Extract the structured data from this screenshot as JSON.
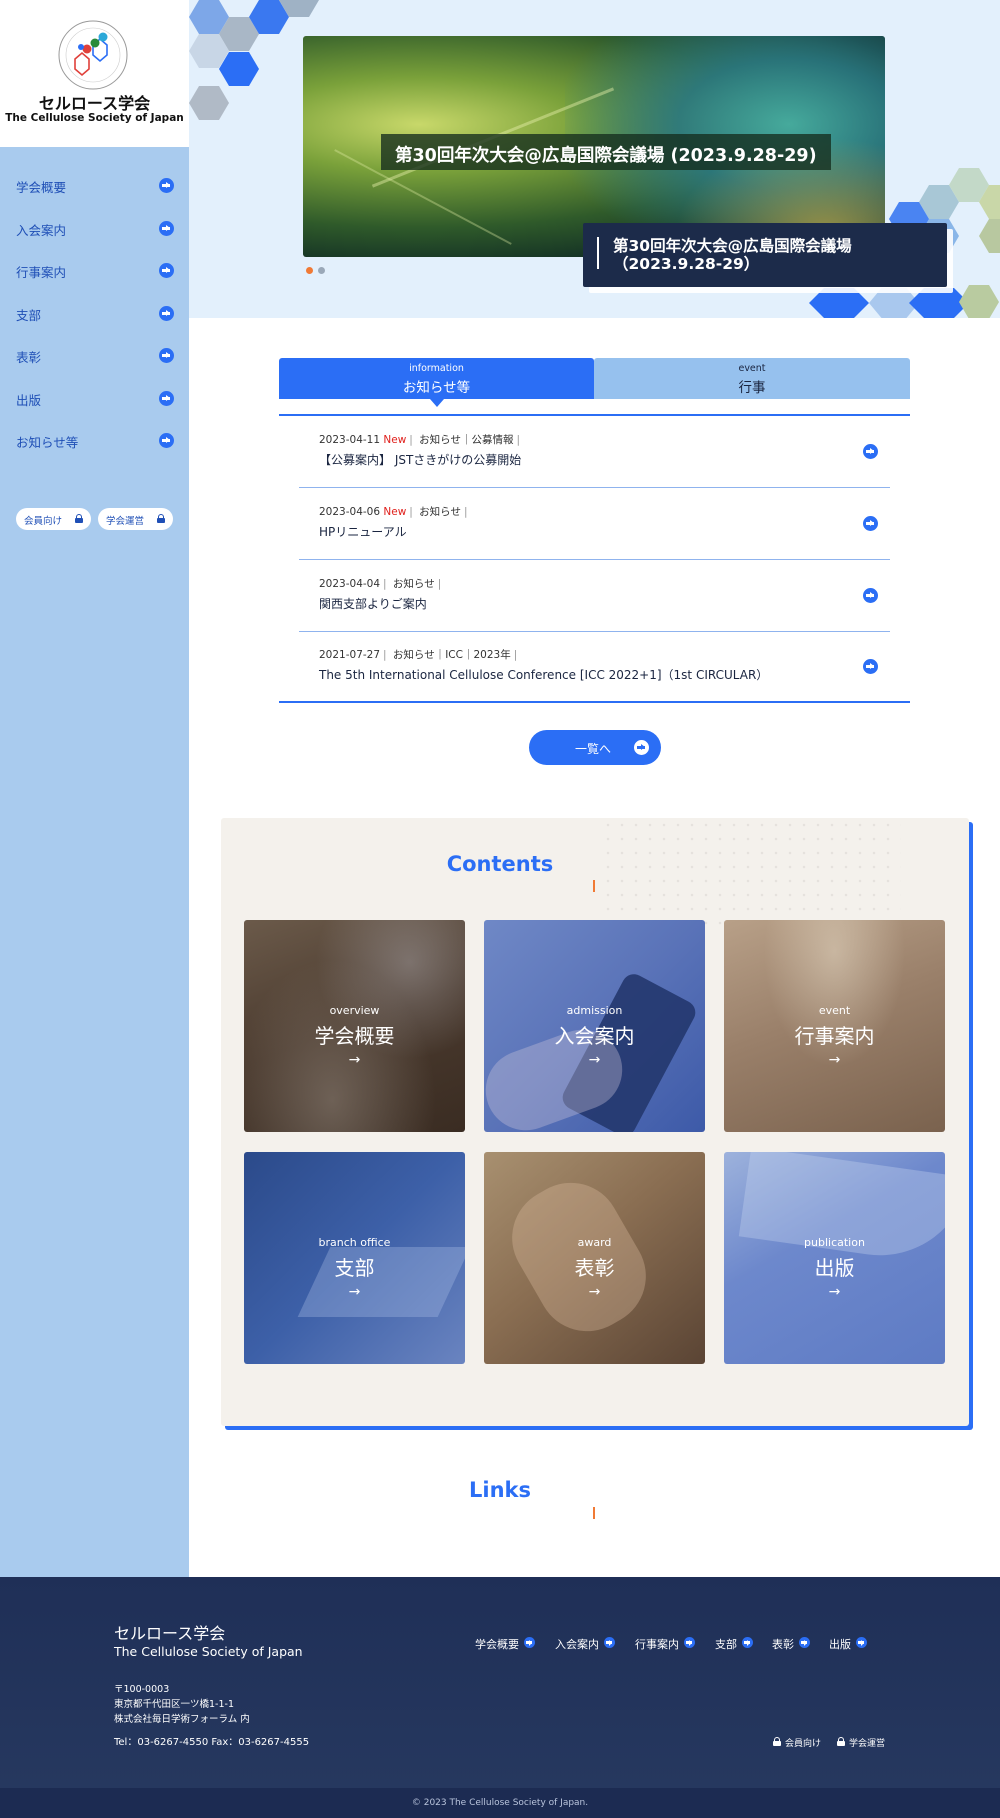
{
  "site": {
    "name_ja": "セルロース学会",
    "name_en": "The Cellulose Society of Japan"
  },
  "sidebar": {
    "items": [
      {
        "label": "学会概要"
      },
      {
        "label": "入会案内"
      },
      {
        "label": "行事案内"
      },
      {
        "label": "支部"
      },
      {
        "label": "表彰"
      },
      {
        "label": "出版"
      },
      {
        "label": "お知らせ等"
      }
    ],
    "pills": [
      {
        "label": "会員向け"
      },
      {
        "label": "学会運営"
      }
    ]
  },
  "hero": {
    "caption": "第30回年次大会@広島国際会議場 (2023.9.28-29)",
    "box_title": "第30回年次大会@広島国際会議場（2023.9.28-29）",
    "slide_dots": 2,
    "active_dot": 1
  },
  "tabs": [
    {
      "en": "information",
      "ja": "お知らせ等",
      "active": true
    },
    {
      "en": "event",
      "ja": "行事",
      "active": false
    }
  ],
  "news": [
    {
      "date": "2023-04-11",
      "new": "New",
      "cats": "お知らせ｜公募情報",
      "title": "【公募案内】 JSTさきがけの公募開始"
    },
    {
      "date": "2023-04-06",
      "new": "New",
      "cats": "お知らせ",
      "title": "HPリニューアル"
    },
    {
      "date": "2023-04-04",
      "new": "",
      "cats": "お知らせ",
      "title": "関西支部よりご案内"
    },
    {
      "date": "2021-07-27",
      "new": "",
      "cats": "お知らせ｜ICC｜2023年",
      "title": "The 5th International Cellulose Conference [ICC 2022+1]（1st CIRCULAR）"
    }
  ],
  "more_button": "一覧へ",
  "contents": {
    "title": "Contents",
    "cards": [
      {
        "en": "overview",
        "ja": "学会概要",
        "arrow": "→"
      },
      {
        "en": "admission",
        "ja": "入会案内",
        "arrow": "→"
      },
      {
        "en": "event",
        "ja": "行事案内",
        "arrow": "→"
      },
      {
        "en": "branch office",
        "ja": "支部",
        "arrow": "→"
      },
      {
        "en": "award",
        "ja": "表彰",
        "arrow": "→"
      },
      {
        "en": "publication",
        "ja": "出版",
        "arrow": "→"
      }
    ]
  },
  "links": {
    "title": "Links"
  },
  "footer": {
    "name_ja": "セルロース学会",
    "name_en": "The Cellulose Society of Japan",
    "postal": "〒100-0003",
    "address1": "東京都千代田区一ツ橋1-1-1",
    "address2": "株式会社毎日学術フォーラム 内",
    "phone": "Tel：03-6267-4550  Fax：03-6267-4555",
    "nav": [
      "学会概要",
      "入会案内",
      "行事案内",
      "支部",
      "表彰",
      "出版"
    ],
    "locks": [
      "会員向け",
      "学会運営"
    ],
    "copyright": "© 2023 The Cellulose Society of Japan."
  },
  "colors": {
    "accent": "#2b6ef5",
    "sidebar_bg": "#a9cbee",
    "footer_bg": "#1f2f57",
    "new_badge": "#e0201c",
    "contents_bg": "#f4f1ec"
  }
}
